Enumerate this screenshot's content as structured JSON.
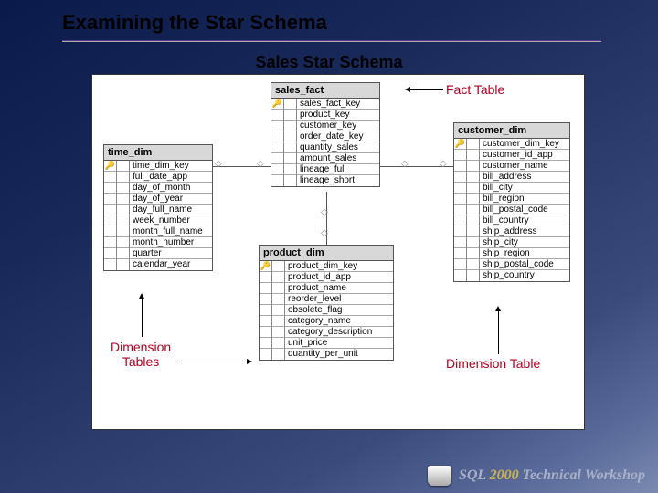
{
  "title": "Examining the Star Schema",
  "subtitle": "Sales Star Schema",
  "labels": {
    "fact_table": "Fact Table",
    "dimension_tables": "Dimension\nTables",
    "dimension_table": "Dimension Table"
  },
  "entities": {
    "sales_fact": {
      "title": "sales_fact",
      "fields": [
        "sales_fact_key",
        "product_key",
        "customer_key",
        "order_date_key",
        "quantity_sales",
        "amount_sales",
        "lineage_full",
        "lineage_short"
      ],
      "keys": [
        0
      ]
    },
    "time_dim": {
      "title": "time_dim",
      "fields": [
        "time_dim_key",
        "full_date_app",
        "day_of_month",
        "day_of_year",
        "day_full_name",
        "week_number",
        "month_full_name",
        "month_number",
        "quarter",
        "calendar_year"
      ],
      "keys": [
        0
      ]
    },
    "product_dim": {
      "title": "product_dim",
      "fields": [
        "product_dim_key",
        "product_id_app",
        "product_name",
        "reorder_level",
        "obsolete_flag",
        "category_name",
        "category_description",
        "unit_price",
        "quantity_per_unit"
      ],
      "keys": [
        0
      ]
    },
    "customer_dim": {
      "title": "customer_dim",
      "fields": [
        "customer_dim_key",
        "customer_id_app",
        "customer_name",
        "bill_address",
        "bill_city",
        "bill_region",
        "bill_postal_code",
        "bill_country",
        "ship_address",
        "ship_city",
        "ship_region",
        "ship_postal_code",
        "ship_country"
      ],
      "keys": [
        0
      ]
    }
  },
  "footer": {
    "brand_a": "SQL ",
    "brand_num": "2000",
    "brand_b": " Technical Workshop"
  }
}
